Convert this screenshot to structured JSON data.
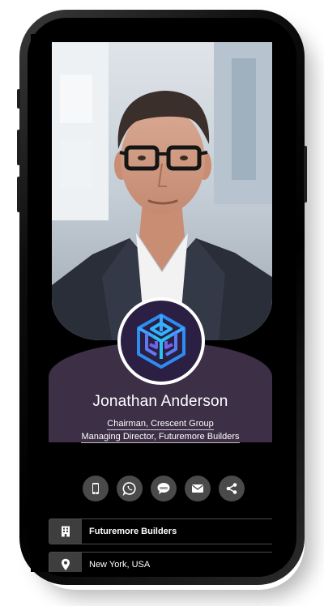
{
  "profile": {
    "name": "Jonathan Anderson",
    "titles": [
      "Chairman, Crescent Group",
      "Managing Director, Futuremore Builders"
    ]
  },
  "actions": [
    {
      "icon": "mobile-phone-icon"
    },
    {
      "icon": "whatsapp-icon"
    },
    {
      "icon": "sms-icon",
      "label": "SMS"
    },
    {
      "icon": "email-icon"
    },
    {
      "icon": "share-icon"
    }
  ],
  "info_rows": [
    {
      "icon": "building-icon",
      "text": "Futuremore Builders"
    },
    {
      "icon": "location-pin-icon",
      "text": "New York, USA"
    }
  ],
  "colors": {
    "card_purple": "#3c2f46",
    "logo_bg": "#2b1f44",
    "action_bg": "#4a4a4a",
    "logo_blue": "#2f8bf0"
  }
}
